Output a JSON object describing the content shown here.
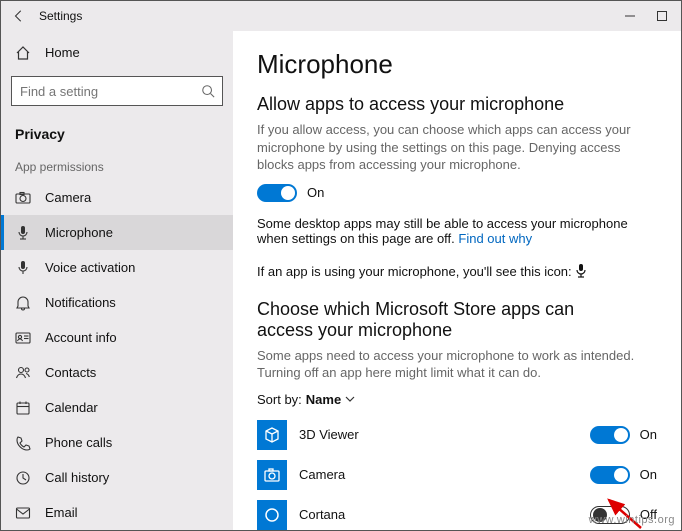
{
  "window": {
    "title": "Settings"
  },
  "sidebar": {
    "home_label": "Home",
    "search_placeholder": "Find a setting",
    "section_label": "Privacy",
    "group_label": "App permissions",
    "items": [
      {
        "label": "Camera"
      },
      {
        "label": "Microphone"
      },
      {
        "label": "Voice activation"
      },
      {
        "label": "Notifications"
      },
      {
        "label": "Account info"
      },
      {
        "label": "Contacts"
      },
      {
        "label": "Calendar"
      },
      {
        "label": "Phone calls"
      },
      {
        "label": "Call history"
      },
      {
        "label": "Email"
      }
    ]
  },
  "main": {
    "title": "Microphone",
    "allow_title": "Allow apps to access your microphone",
    "allow_desc": "If you allow access, you can choose which apps can access your microphone by using the settings on this page. Denying access blocks apps from accessing your microphone.",
    "allow_state": "On",
    "desktop_note": "Some desktop apps may still be able to access your microphone when settings on this page are off. ",
    "find_out_link": "Find out why",
    "in_use_note": "If an app is using your microphone, you'll see this icon:",
    "choose_title": "Choose which Microsoft Store apps can access your microphone",
    "choose_desc": "Some apps need to access your microphone to work as intended. Turning off an app here might limit what it can do.",
    "sort_label": "Sort by:",
    "sort_value": "Name",
    "apps": [
      {
        "name": "3D Viewer",
        "state": "On"
      },
      {
        "name": "Camera",
        "state": "On"
      },
      {
        "name": "Cortana",
        "state": "Off"
      }
    ]
  },
  "watermark": "www.wintips.org"
}
